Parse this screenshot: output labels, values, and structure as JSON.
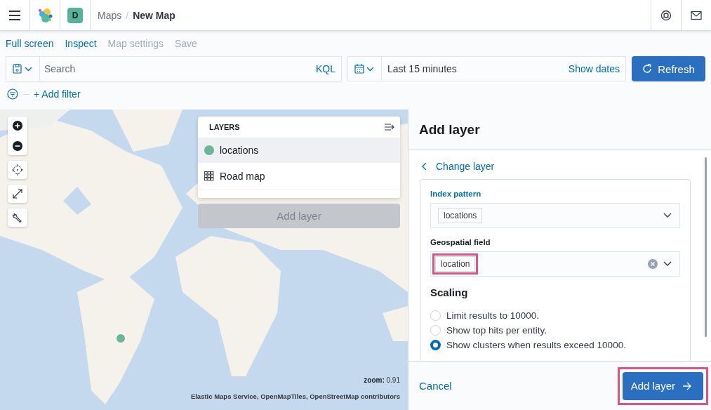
{
  "header": {
    "avatar": "D",
    "separator": "/",
    "breadcrumbs": [
      {
        "label": "Maps",
        "current": false
      },
      {
        "label": "New Map",
        "current": true
      }
    ]
  },
  "top_nav": [
    {
      "label": "Full screen",
      "disabled": false
    },
    {
      "label": "Inspect",
      "disabled": false
    },
    {
      "label": "Map settings",
      "disabled": true
    },
    {
      "label": "Save",
      "disabled": true
    }
  ],
  "query_bar": {
    "placeholder": "Search",
    "language": "KQL",
    "time_range": "Last 15 minutes",
    "show_dates": "Show dates",
    "refresh": "Refresh"
  },
  "filter_bar": {
    "add_filter": "+ Add filter"
  },
  "map": {
    "zoom_label": "zoom:",
    "zoom_value": "0.91",
    "attribution": "Elastic Maps Service, OpenMapTiles, OpenStreetMap contributors"
  },
  "layers_panel": {
    "title": "LAYERS",
    "layers": [
      {
        "name": "locations",
        "kind": "points",
        "selected": true,
        "color": "#6db596"
      },
      {
        "name": "Road map",
        "kind": "tiles",
        "selected": false
      }
    ],
    "add_button": "Add layer"
  },
  "flyout": {
    "title": "Add layer",
    "back_link": "Change layer",
    "index_pattern": {
      "label": "Index pattern",
      "value": "locations"
    },
    "geo_field": {
      "label": "Geospatial field",
      "value": "location",
      "highlighted": true
    },
    "scaling": {
      "title": "Scaling",
      "options": [
        {
          "label": "Limit results to 10000.",
          "selected": false
        },
        {
          "label": "Show top hits per entity.",
          "selected": false
        },
        {
          "label": "Show clusters when results exceed 10000.",
          "selected": true
        }
      ]
    },
    "cancel": "Cancel",
    "submit": {
      "label": "Add layer",
      "highlighted": true
    }
  }
}
